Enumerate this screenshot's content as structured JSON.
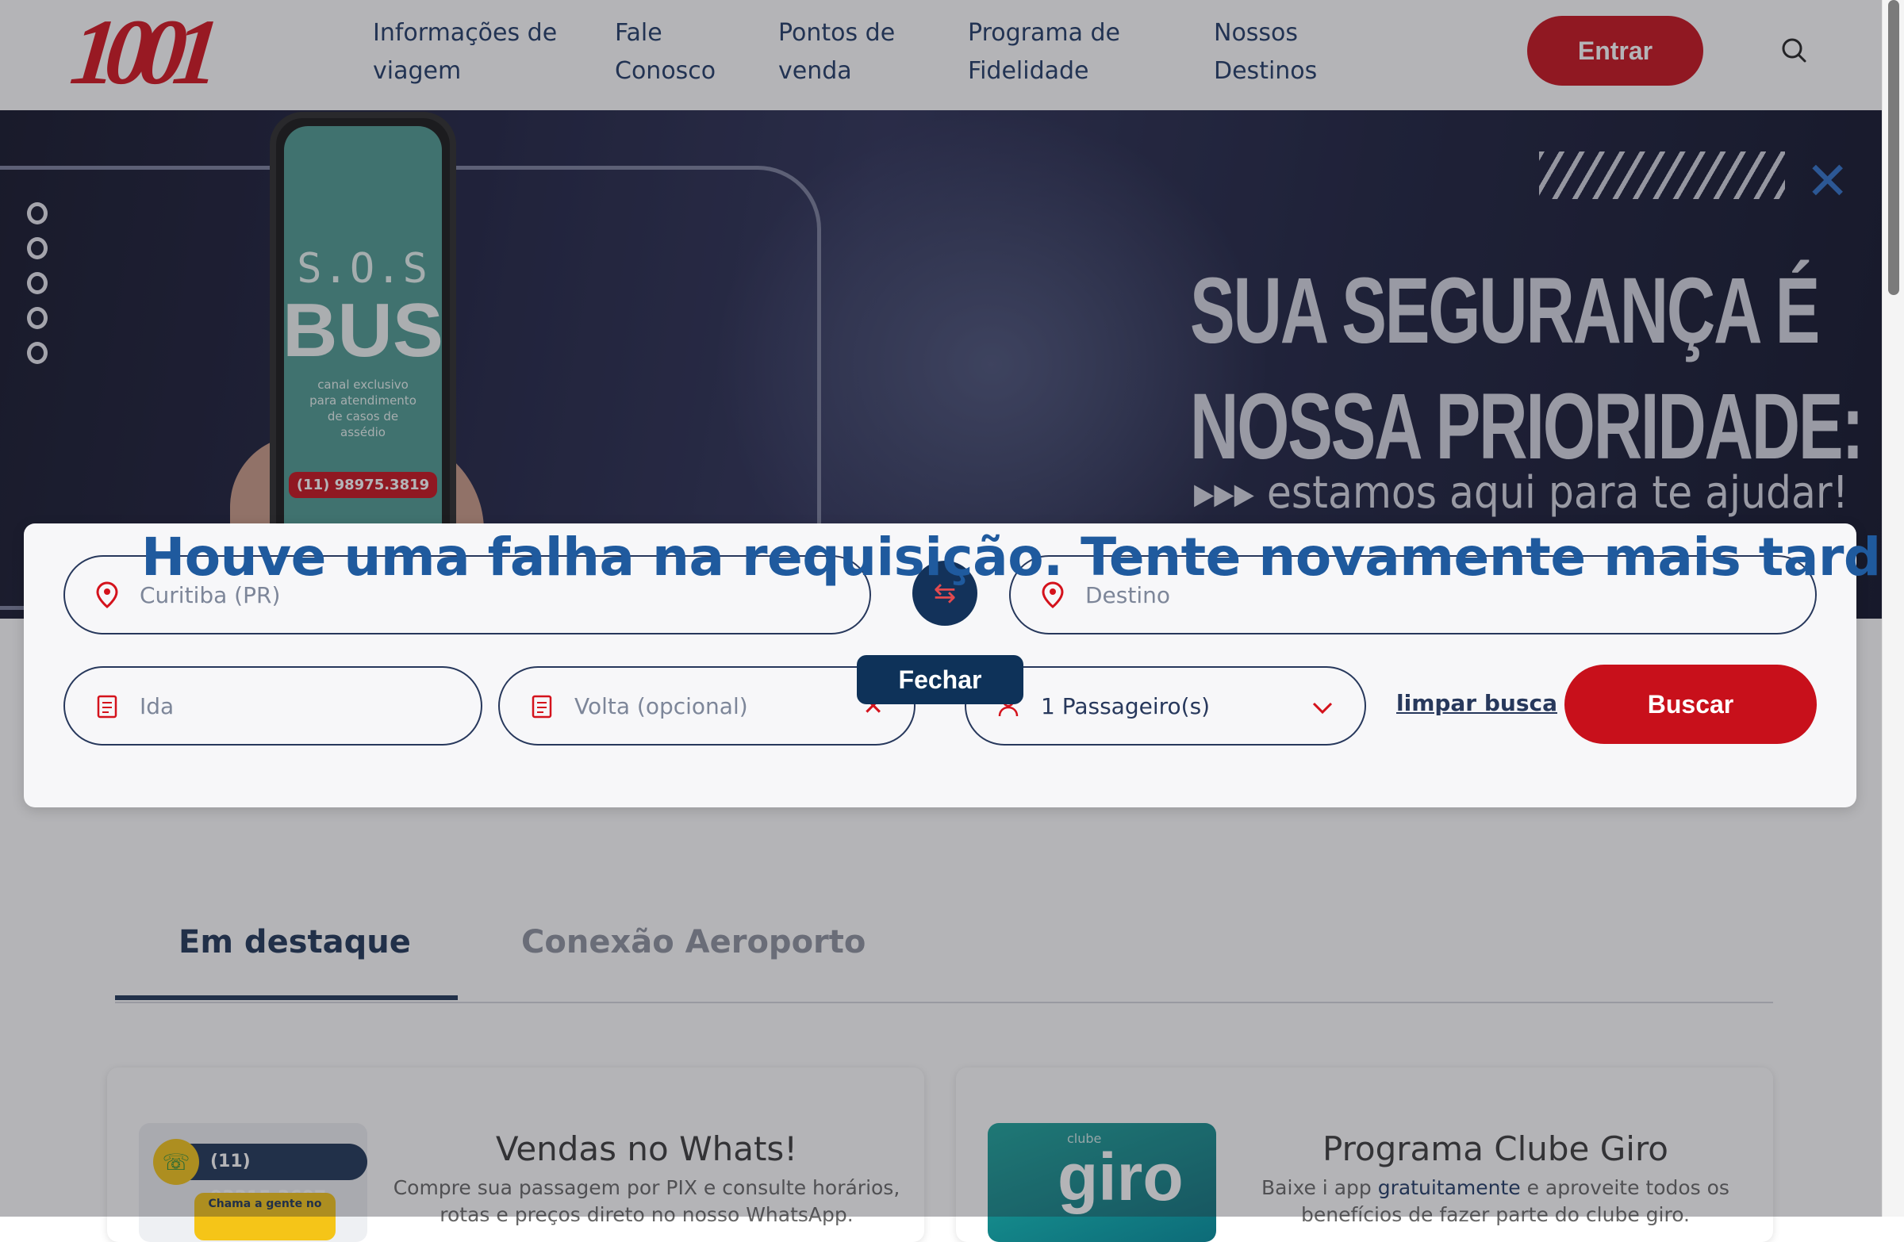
{
  "header": {
    "logo_text": "1001",
    "nav": [
      {
        "label": "Informações de\nviagem"
      },
      {
        "label": "Fale\nConosco"
      },
      {
        "label": "Pontos de\nvenda"
      },
      {
        "label": "Programa de\nFidelidade"
      },
      {
        "label": "Nossos\nDestinos"
      }
    ],
    "login_label": "Entrar",
    "search_icon": "search-icon"
  },
  "hero": {
    "phone_sos": "S.O.S",
    "phone_bus": "BUS",
    "phone_caption": "canal exclusivo para atendimento de casos de assédio",
    "phone_number": "(11) 98975.3819",
    "title_line1": "SUA SEGURANÇA É",
    "title_line2": "NOSSA PRIORIDADE:",
    "subtitle": "▸▸▸ estamos aqui para te ajudar!",
    "close_icon": "close-icon",
    "slides_total": 2,
    "active_slide": 1
  },
  "search": {
    "origin_value": "Curitiba (PR)",
    "destination_placeholder": "Destino",
    "departure_placeholder": "Ida",
    "return_placeholder": "Volta (opcional)",
    "passengers_value": "1 Passageiro(s)",
    "clear_label": "limpar busca",
    "submit_label": "Buscar"
  },
  "alert": {
    "message": "Houve uma falha na requisição. Tente novamente mais tarde.",
    "close_label": "Fechar"
  },
  "tabs": [
    {
      "label": "Em destaque",
      "active": true
    },
    {
      "label": "Conexão Aeroporto",
      "active": false
    }
  ],
  "cards": [
    {
      "title": "Vendas no Whats!",
      "description": "Compre sua passagem por PIX e consulte horários, rotas e preços direto no nosso WhatsApp.",
      "image_phone": "(11) 93315.3607",
      "image_caption": "Chama a gente no"
    },
    {
      "title": "Programa Clube Giro",
      "description_pre": "Baixe i app ",
      "description_highlight": "gratuitamente",
      "description_post": " e aproveite todos os benefícios de fazer parte do clube giro.",
      "image_small": "clube",
      "image_big": "giro"
    }
  ],
  "colors": {
    "brand_red": "#c8101b",
    "navy": "#1e3556",
    "alert_blue": "#1f5a9e"
  }
}
